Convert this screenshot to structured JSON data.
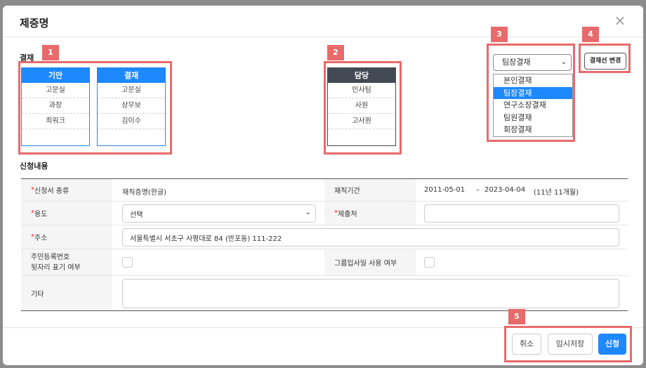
{
  "modal": {
    "title": "제증명",
    "close_icon": "×"
  },
  "approval": {
    "label": "결재",
    "columns": [
      {
        "head": "기안",
        "rows": [
          "고문실",
          "과장",
          "최워크",
          ""
        ]
      },
      {
        "head": "결재",
        "rows": [
          "고문실",
          "상무보",
          "김이수",
          ""
        ]
      }
    ],
    "handler": {
      "head": "담당",
      "rows": [
        "인사팀",
        "사원",
        "고사원",
        ""
      ]
    },
    "line_select": {
      "selected": "팀장결재",
      "options": [
        "본인결재",
        "팀장결재",
        "연구소장결재",
        "팀원결재",
        "회장결재"
      ],
      "highlighted_index": 1
    },
    "change_button": "결재선 변경"
  },
  "badges": [
    "1",
    "2",
    "3",
    "4",
    "5"
  ],
  "form": {
    "label": "신청내용",
    "type_label": "신청서 종류",
    "type_value": "재직증명(한글)",
    "period_label": "재직기간",
    "period_start": "2011-05-01",
    "period_sep": "–",
    "period_end": "2023-04-04",
    "period_len": "(11년 11개월)",
    "purpose_label": "용도",
    "purpose_value": "선택",
    "submit_to_label": "제출처",
    "submit_to_value": "",
    "address_label": "주소",
    "address_value": "서울특별시 서초구 사평대로 84 (반포동) 111-222",
    "rrn_label_1": "주민등록번호",
    "rrn_label_2": "뒷자리 표기 여부",
    "group_join_label": "그룹입사일 사용 여부",
    "etc_label": "기타",
    "etc_value": "",
    "required_mark": "*"
  },
  "footer": {
    "cancel": "취소",
    "draft": "임시저장",
    "submit": "신청"
  },
  "colors": {
    "accent": "#1e88ff",
    "handler_head": "#444a55",
    "annotation": "#e86a6a",
    "required": "#e03030"
  }
}
